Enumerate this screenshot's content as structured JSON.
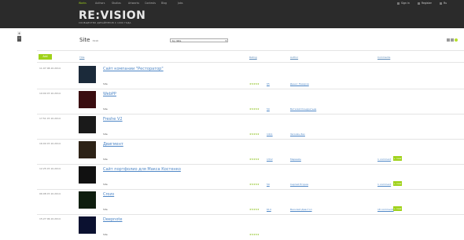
{
  "topnav": [
    "Works",
    "Authors",
    "Studios",
    "Artworks",
    "Contests",
    "Blog",
    "Jobs"
  ],
  "logo": {
    "text": "RE:VISION",
    "subtitle": "СООБЩЕСТВО ДИЗАЙНЕРОВ С 1999 ГОДА"
  },
  "user_links": [
    "Sign in",
    "Register",
    "Ru"
  ],
  "page": {
    "title": "Site",
    "subtitle": "3416",
    "sort": "by date",
    "accent": "#9fd21a"
  },
  "table_headers": {
    "add": "Add",
    "title": "Title",
    "rating": "Rating",
    "author": "Author",
    "comments": "Comments"
  },
  "rows": [
    {
      "time": "11:07 08.10.2014",
      "title": "Сайт компании \"Ресторатор\"",
      "site": "Site",
      "votes": "65",
      "author": "Денис Назаров",
      "comments": "",
      "badge": "",
      "thumb": "dark-blue-site"
    },
    {
      "time": "19:09 07.10.2014",
      "title": "WebPP",
      "site": "Site",
      "votes": "59",
      "author": "Виталий Кондратьев",
      "comments": "",
      "badge": "",
      "thumb": "red-dark-site"
    },
    {
      "time": "17:51 07.10.2014",
      "title": "Freshe V2",
      "site": "Site",
      "votes": "1411",
      "author": "Yaroslav Zav",
      "comments": "",
      "badge": "",
      "thumb": "freshe"
    },
    {
      "time": "16:00 07.10.2014",
      "title": "Двигмент",
      "site": "Site",
      "votes": "1312",
      "author": "Мервайн",
      "comments": "1 comment",
      "badge": "+ new",
      "thumb": "hand"
    },
    {
      "time": "12:25 07.10.2014",
      "title": "Сайт портфолио для Макса Костенко",
      "site": "Site",
      "votes": "59",
      "author": "Сергей Егоров",
      "comments": "1 comment",
      "badge": "+ new",
      "thumb": "portfolio"
    },
    {
      "time": "06:08 07.10.2014",
      "title": "Crozo",
      "site": "Site",
      "votes": "614",
      "author": "Василий Диастол",
      "comments": "18 comments",
      "badge": "+ new",
      "thumb": "crozo"
    },
    {
      "time": "15:27 06.10.2014",
      "title": "Deepnote",
      "site": "Site",
      "votes": "",
      "author": "",
      "comments": "",
      "badge": "",
      "thumb": "deepnote"
    }
  ]
}
